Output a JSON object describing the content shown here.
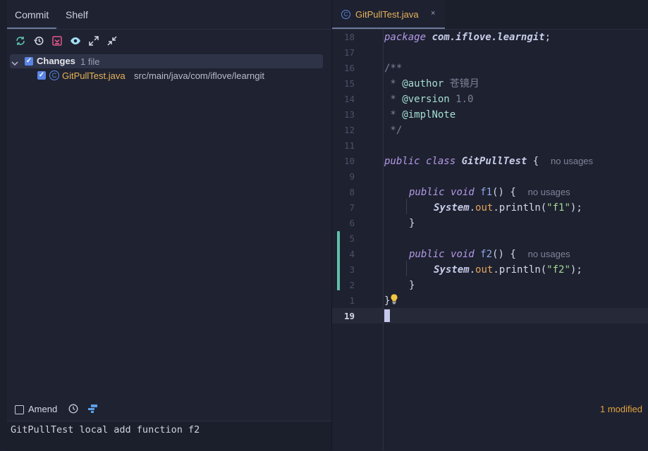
{
  "left_panel": {
    "tabs": [
      "Commit",
      "Shelf"
    ],
    "toolbar_icons": [
      "refresh-icon",
      "rollback-icon",
      "shelve-icon",
      "preview-icon",
      "expand-all-icon",
      "collapse-all-icon"
    ],
    "changes_label": "Changes",
    "changes_count": "1 file",
    "file": {
      "name": "GitPullTest.java",
      "path": "src/main/java/com/iflove/learngit"
    },
    "amend_label": "Amend",
    "modified_label": "1 modified",
    "commit_message": "GitPullTest local add function f2"
  },
  "editor": {
    "tab_label": "GitPullTest.java",
    "tab_close": "×",
    "line_numbers": [
      "18",
      "17",
      "16",
      "15",
      "14",
      "13",
      "12",
      "11",
      "10",
      "9",
      "8",
      "7",
      "6",
      "5",
      "4",
      "3",
      "2",
      "1",
      "19"
    ],
    "code": {
      "l18": {
        "kw": "package",
        "rest": "com.iflove.learngit",
        "semi": ";"
      },
      "l16": "/**",
      "l15": {
        "star": " * ",
        "tag": "@author",
        "text": " 苍镜月"
      },
      "l14": {
        "star": " * ",
        "tag": "@version",
        "text": " 1.0"
      },
      "l13": {
        "star": " * ",
        "tag": "@implNote"
      },
      "l12": " */",
      "l10": {
        "kw1": "public",
        "kw2": "class",
        "name": "GitPullTest",
        "brace": " {",
        "hint": "no usages"
      },
      "l8": {
        "kw1": "public",
        "kw2": "void",
        "name": "f1",
        "rest": "() {",
        "hint": "no usages"
      },
      "l7": {
        "cls": "System",
        "dot": ".",
        "field": "out",
        "call": ".println(",
        "str": "\"f1\"",
        "end": ");"
      },
      "l6": "}",
      "l4": {
        "kw1": "public",
        "kw2": "void",
        "name": "f2",
        "rest": "() {",
        "hint": "no usages"
      },
      "l3": {
        "cls": "System",
        "dot": ".",
        "field": "out",
        "call": ".println(",
        "str": "\"f2\"",
        "end": ");"
      },
      "l2": "}",
      "l1": "}"
    }
  },
  "colors": {
    "background": "#1e2130",
    "accent": "#5a85e6",
    "vcs_change": "#5fbfac",
    "modified": "#e1a33f",
    "filename": "#e6b45a"
  }
}
